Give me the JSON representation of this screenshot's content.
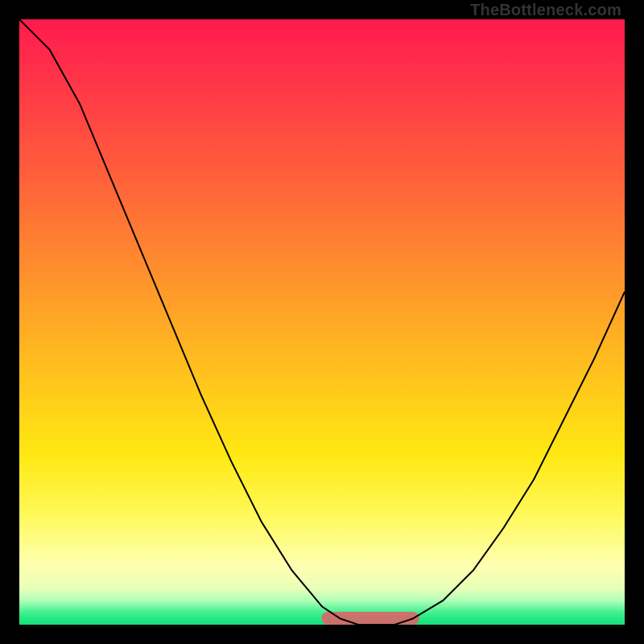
{
  "watermark": "TheBottleneck.com",
  "domain_note": "bottleneck-curve-plot",
  "chart_data": {
    "type": "line",
    "title": "",
    "xlabel": "",
    "ylabel": "",
    "xlim": [
      0,
      100
    ],
    "ylim": [
      0,
      100
    ],
    "series": [
      {
        "name": "bottleneck-curve",
        "x": [
          0,
          5,
          10,
          15,
          20,
          25,
          30,
          35,
          40,
          45,
          50,
          53,
          56,
          59,
          62,
          65,
          70,
          75,
          80,
          85,
          90,
          95,
          100
        ],
        "values": [
          100,
          95,
          86,
          74,
          62,
          50,
          38,
          27,
          17,
          9,
          3,
          1,
          0,
          0,
          0,
          1,
          4,
          9,
          16,
          24,
          34,
          44,
          55
        ]
      }
    ],
    "annotations": [
      {
        "name": "optimal-band",
        "x_start": 51,
        "x_end": 65,
        "y": 0
      }
    ]
  }
}
